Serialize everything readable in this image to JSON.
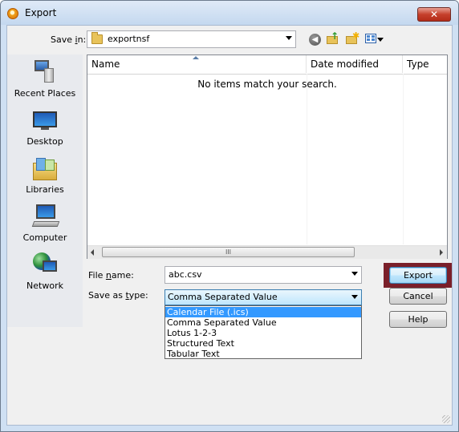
{
  "window": {
    "title": "Export",
    "close_glyph": "✕"
  },
  "toolbar": {
    "save_in_label": "Save in:",
    "save_in_value": "exportnsf",
    "icons": [
      "back-icon",
      "up-folder-icon",
      "new-folder-icon",
      "views-menu-icon"
    ]
  },
  "places": [
    {
      "label": "Recent Places",
      "icon": "recent-places-icon"
    },
    {
      "label": "Desktop",
      "icon": "desktop-icon"
    },
    {
      "label": "Libraries",
      "icon": "libraries-icon"
    },
    {
      "label": "Computer",
      "icon": "computer-icon"
    },
    {
      "label": "Network",
      "icon": "network-icon"
    }
  ],
  "filelist": {
    "columns": [
      "Name",
      "Date modified",
      "Type"
    ],
    "empty_message": "No items match your search.",
    "scroll_thumb_glyph": "III"
  },
  "form": {
    "file_name_label": "File name:",
    "file_name_value": "abc.csv",
    "save_as_type_label": "Save as type:",
    "save_as_type_value": "Comma Separated Value",
    "type_options": [
      "Calendar File (.ics)",
      "Comma Separated Value",
      "Lotus 1-2-3",
      "Structured Text",
      "Tabular Text"
    ],
    "highlighted_option": "Calendar File (.ics)"
  },
  "buttons": {
    "export": "Export",
    "cancel": "Cancel",
    "help": "Help"
  },
  "colors": {
    "highlight": "#3399ff",
    "export_frame": "#7a1f2a",
    "close_button": "#c6402c"
  }
}
